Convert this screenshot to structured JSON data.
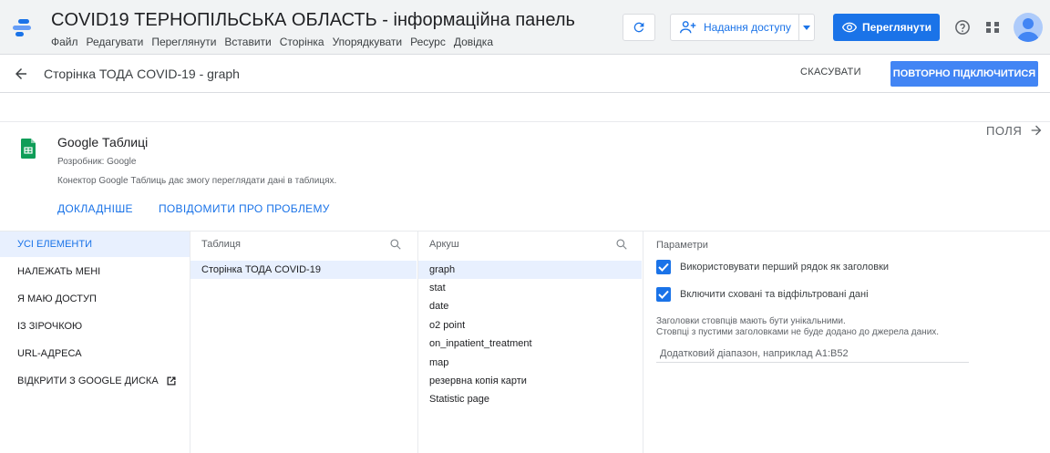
{
  "app": {
    "title": "COVID19 ТЕРНОПІЛЬСЬКА ОБЛАСТЬ - інформаційна панель",
    "menu": [
      "Файл",
      "Редагувати",
      "Переглянути",
      "Вставити",
      "Сторінка",
      "Упорядкувати",
      "Ресурс",
      "Довідка"
    ],
    "share_label": "Надання доступу",
    "view_label": "Переглянути",
    "accent": "#1a73e8"
  },
  "subbar": {
    "title": "Сторінка ТОДА COVID-19 - graph",
    "cancel_label": "СКАСУВАТИ",
    "reconnect_label": "ПОВТОРНО ПІДКЛЮЧИТИСЯ"
  },
  "fields_label": "ПОЛЯ",
  "connector": {
    "name": "Google Таблиці",
    "developer": "Розробник: Google",
    "description": "Конектор Google Таблиць дає змогу переглядати дані в таблицях.",
    "more_label": "ДОКЛАДНІШЕ",
    "report_label": "ПОВІДОМИТИ ПРО ПРОБЛЕМУ"
  },
  "nav": {
    "items": [
      "УСІ ЕЛЕМЕНТИ",
      "НАЛЕЖАТЬ МЕНІ",
      "Я МАЮ ДОСТУП",
      "ІЗ ЗІРОЧКОЮ",
      "URL-АДРЕСА",
      "ВІДКРИТИ З GOOGLE ДИСКА"
    ],
    "active_index": 0
  },
  "tables": {
    "header": "Таблиця",
    "items": [
      "Сторінка ТОДА COVID-19"
    ]
  },
  "sheets": {
    "header": "Аркуш",
    "items": [
      "graph",
      "stat",
      "date",
      "o2 point",
      "on_inpatient_treatment",
      "map",
      "резервна копія карти",
      "Statistic page"
    ],
    "selected_index": 0
  },
  "params": {
    "header": "Параметри",
    "option1": "Використовувати перший рядок як заголовки",
    "option1_checked": true,
    "option2": "Включити сховані та відфільтровані дані",
    "option2_checked": true,
    "note_line1": "Заголовки стовпців мають бути унікальними.",
    "note_line2": "Стовпці з пустими заголовками не буде додано до джерела даних.",
    "range_placeholder": "Додатковий діапазон, наприклад A1:B52"
  }
}
